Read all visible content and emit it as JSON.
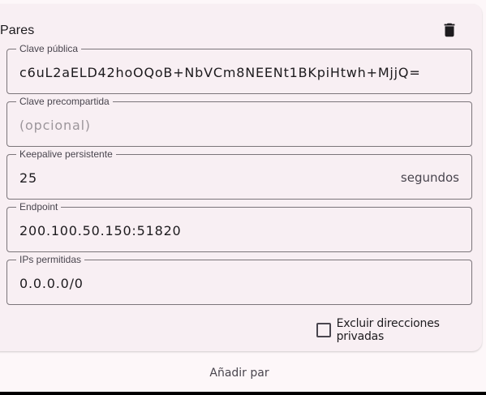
{
  "peer": {
    "title": "Pares",
    "delete_icon": "trash-icon"
  },
  "fields": {
    "public_key": {
      "label": "Clave pública",
      "value": "c6uL2aELD42hoOQoB+NbVCm8NEENt1BKpiHtwh+MjjQ="
    },
    "preshared_key": {
      "label": "Clave precompartida",
      "value": "",
      "placeholder": "(opcional)"
    },
    "keepalive": {
      "label": "Keepalive persistente",
      "value": "25",
      "suffix": "segundos"
    },
    "endpoint": {
      "label": "Endpoint",
      "value": "200.100.50.150:51820"
    },
    "allowed_ips": {
      "label": "IPs permitidas",
      "value": "0.0.0.0/0"
    }
  },
  "exclude_private": {
    "label": "Excluir direcciones privadas",
    "checked": false
  },
  "add_peer_label": "Añadir par"
}
